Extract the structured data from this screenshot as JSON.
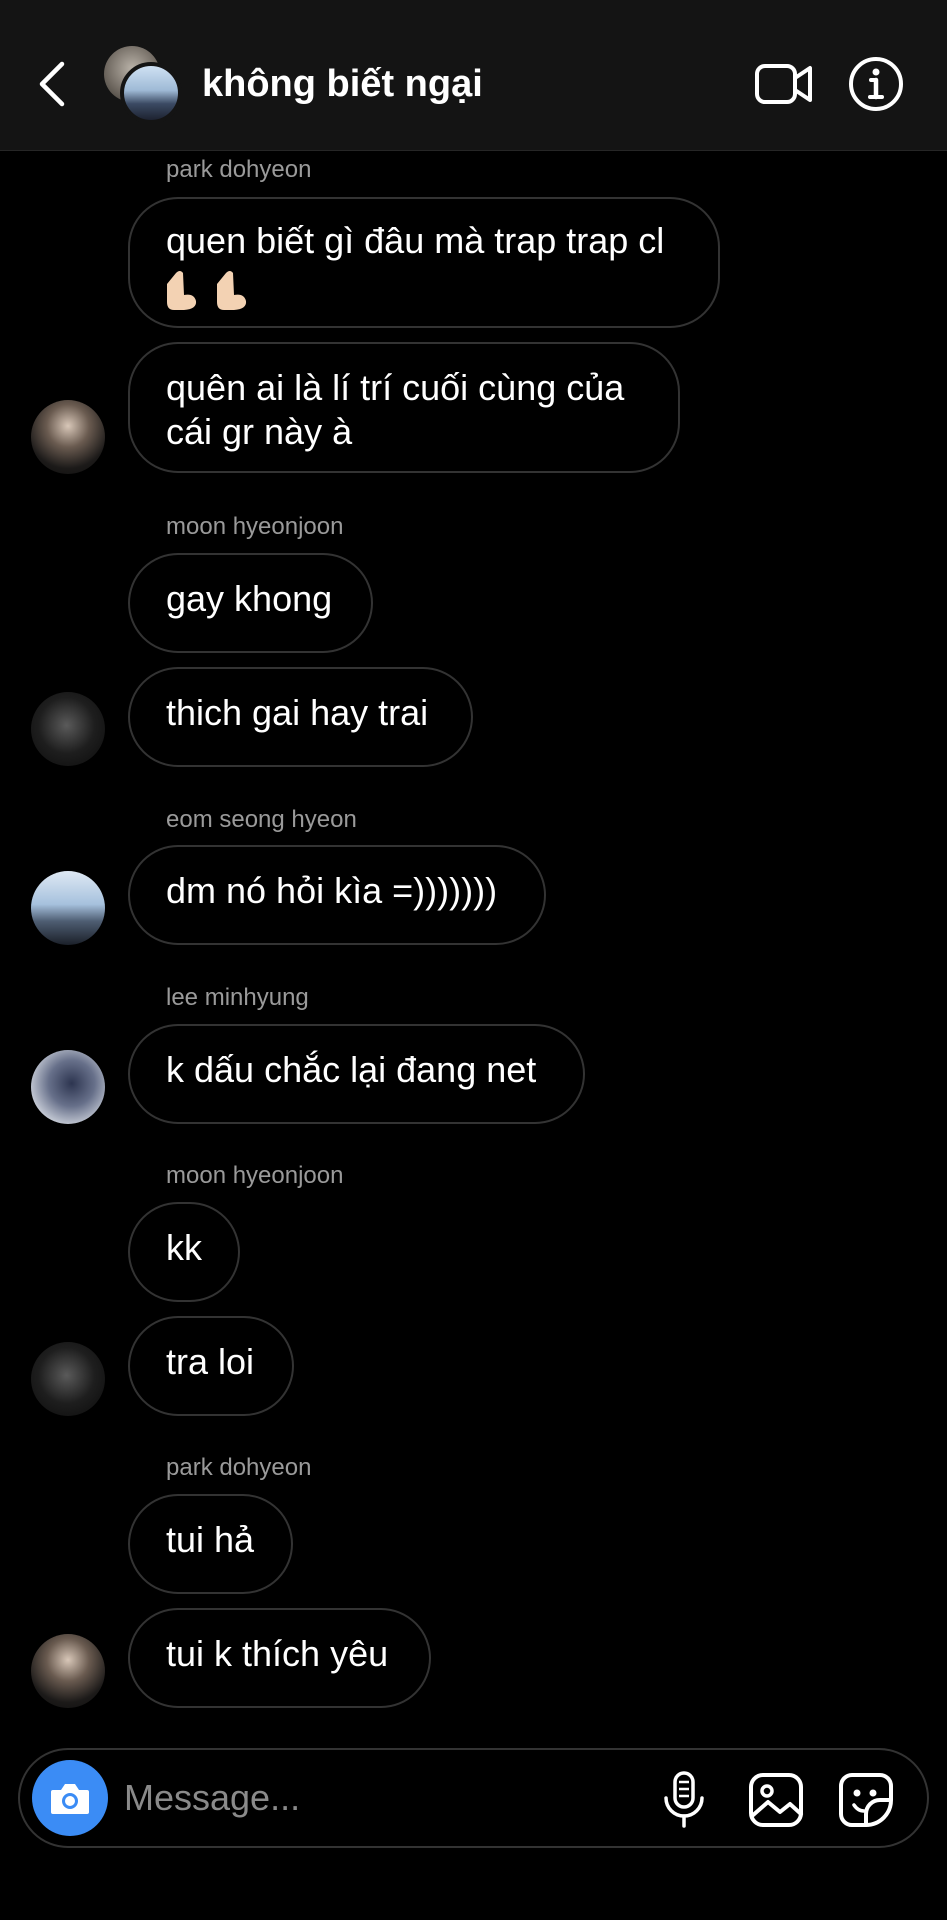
{
  "header": {
    "title": "không biết ngại"
  },
  "messages": [
    {
      "sender": "park dohyeon",
      "text": "quen biết gì đâu mà trap trap cl",
      "emoji": "🤳🤳"
    },
    {
      "text": "quên ai là lí trí cuối cùng của cái gr này à"
    },
    {
      "sender": "moon hyeonjoon",
      "text": "gay khong"
    },
    {
      "text": "thich gai hay trai"
    },
    {
      "sender": "eom seong hyeon",
      "text": "dm nó hỏi kìa =)))))))"
    },
    {
      "sender": "lee minhyung",
      "text": "k dấu chắc lại đang net"
    },
    {
      "sender": "moon hyeonjoon",
      "text": "kk"
    },
    {
      "text": "tra loi"
    },
    {
      "sender": "park dohyeon",
      "text": "tui hả"
    },
    {
      "text": "tui k thích yêu"
    }
  ],
  "composer": {
    "placeholder": "Message..."
  },
  "colors": {
    "accent": "#3b8cf5",
    "background": "#000000",
    "header_bg": "#141414",
    "bubble_border": "#333333",
    "sender_text": "#9a9a9a"
  },
  "icons": {
    "back": "chevron-left-icon",
    "video": "video-camera-icon",
    "info": "info-icon",
    "camera": "camera-icon",
    "mic": "microphone-icon",
    "gallery": "image-icon",
    "sticker": "sticker-icon"
  }
}
